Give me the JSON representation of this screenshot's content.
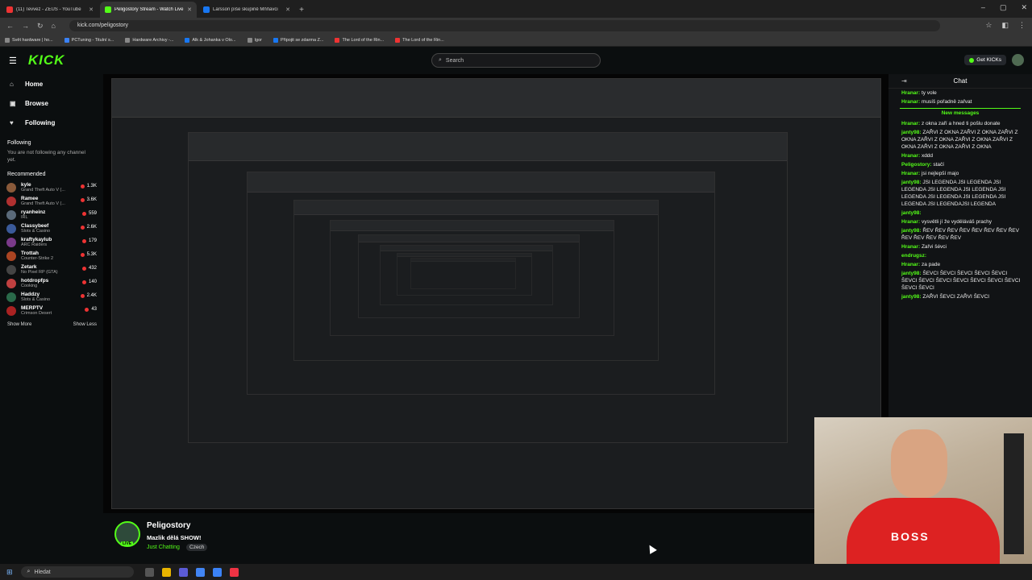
{
  "tabs": [
    {
      "title": "(11) Tevvez - ZEUS - YouTube",
      "color": "#e33"
    },
    {
      "title": "Peligostory Stream - Watch Live",
      "color": "#53fc18",
      "active": true
    },
    {
      "title": "Larsson píše skupině Mňňavci",
      "color": "#1877f2"
    }
  ],
  "address": {
    "url": "kick.com/peligostory"
  },
  "bookmarks": [
    {
      "label": "Svět hardware | ho...",
      "color": "#888"
    },
    {
      "label": "PCTuning - Titulní s...",
      "color": "#3b82f6"
    },
    {
      "label": "Hardware Archivy -...",
      "color": "#888"
    },
    {
      "label": "Alk & Johanka v Olo...",
      "color": "#1877f2"
    },
    {
      "label": "Igor",
      "color": "#888"
    },
    {
      "label": "Připojit se zdarma Z...",
      "color": "#1877f2"
    },
    {
      "label": "The Lord of the Rin...",
      "color": "#e33"
    },
    {
      "label": "The Lord of the Rin...",
      "color": "#e33"
    }
  ],
  "header": {
    "search_placeholder": "Search",
    "get_kicks": "Get KICKs"
  },
  "sidebar": {
    "nav": [
      {
        "label": "Home",
        "icon": "⌂"
      },
      {
        "label": "Browse",
        "icon": "▣"
      },
      {
        "label": "Following",
        "icon": "♥"
      }
    ],
    "following_title": "Following",
    "following_note": "You are not following any channel yet.",
    "recommended_title": "Recommended",
    "recommended": [
      {
        "name": "kyle",
        "game": "Grand Theft Auto V (...",
        "viewers": "1.3K",
        "color": "#8a5a3a"
      },
      {
        "name": "Ramee",
        "game": "Grand Theft Auto V (...",
        "viewers": "3.6K",
        "color": "#b03030"
      },
      {
        "name": "ryanheinz",
        "game": "IRL",
        "viewers": "559",
        "color": "#5a6a7a"
      },
      {
        "name": "Classybeef",
        "game": "Slots & Casino",
        "viewers": "2.6K",
        "color": "#3a5a9a"
      },
      {
        "name": "kraftykaylub",
        "game": "ARC Raiders",
        "viewers": "179",
        "color": "#7a3a8a"
      },
      {
        "name": "Trottah",
        "game": "Counter-Strike 2",
        "viewers": "5.3K",
        "color": "#aa4422"
      },
      {
        "name": "Zetark",
        "game": "No Pixel RP (GTA)",
        "viewers": "432",
        "color": "#444"
      },
      {
        "name": "hotdropfps",
        "game": "Cooking",
        "viewers": "140",
        "color": "#c04040"
      },
      {
        "name": "Haddzy",
        "game": "Slots & Casino",
        "viewers": "2.4K",
        "color": "#2a6a4a"
      },
      {
        "name": "MERPTV",
        "game": "Crimson Desert",
        "viewers": "43",
        "color": "#aa2222"
      }
    ],
    "show_more": "Show More",
    "show_less": "Show Less"
  },
  "chat": {
    "title": "Chat",
    "new_messages": "New messages",
    "messages_top": [
      {
        "user": "Hranar:",
        "text": "ty vole"
      },
      {
        "user": "Hranar:",
        "text": "musíš pořadně zařvat"
      }
    ],
    "messages": [
      {
        "user": "Hranar:",
        "text": "z okna zaří a hned ti pošlu donate"
      },
      {
        "user": "janty98:",
        "text": "ZAŘVI Z OKNA ZAŘVI Z OKNA ZAŘVI Z OKNA ZAŘVI Z OKNA ZAŘVI Z OKNA ZAŘVI Z OKNA ZAŘVI Z OKNA ZAŘVI Z OKNA"
      },
      {
        "user": "Hranar:",
        "text": "xddd"
      },
      {
        "user": "Peligostory:",
        "text": "stačí"
      },
      {
        "user": "Hranar:",
        "text": "jsi nejlepší majo"
      },
      {
        "user": "janty98:",
        "text": "JSI LEGENDA JSI LEGENDA JSI LEGENDA JSI LEGENDA JSI LEGENDA JSI LEGENDA JSI LEGENDA JSI LEGENDA JSI LEGENDA JSI LEGENDAJSI LEGENDA"
      },
      {
        "user": "janty98:",
        "text": ""
      },
      {
        "user": "Hranar:",
        "text": "vysvětli jí že vyděláváš prachy"
      },
      {
        "user": "janty98:",
        "text": "ŘEV ŘEV ŘEV ŘEV ŘEV ŘEV ŘEV ŘEV ŘEV ŘEV ŘEV ŘEV ŘEV"
      },
      {
        "user": "Hranar:",
        "text": "Zařvi šévci"
      },
      {
        "user": "endrugsz:",
        "text": ""
      },
      {
        "user": "Hranar:",
        "text": "za pade"
      },
      {
        "user": "janty98:",
        "text": "ŠEVCI ŠEVCI ŠEVCI ŠEVCI ŠEVCI ŠEVCI ŠEVCI ŠEVCI ŠEVCI ŠEVCI ŠEVCI ŠEVCI ŠEVCI ŠEVCI"
      },
      {
        "user": "janty98:",
        "text": "ZAŘVI ŠEVCI ZAŘVI ŠEVCI"
      }
    ]
  },
  "stream": {
    "streamer": "Peligostory",
    "title": "Mazlik dělá SHOW!",
    "category": "Just Chatting",
    "language": "Czech",
    "live_badge": "LIVE"
  },
  "taskbar": {
    "search_placeholder": "Hledat"
  }
}
